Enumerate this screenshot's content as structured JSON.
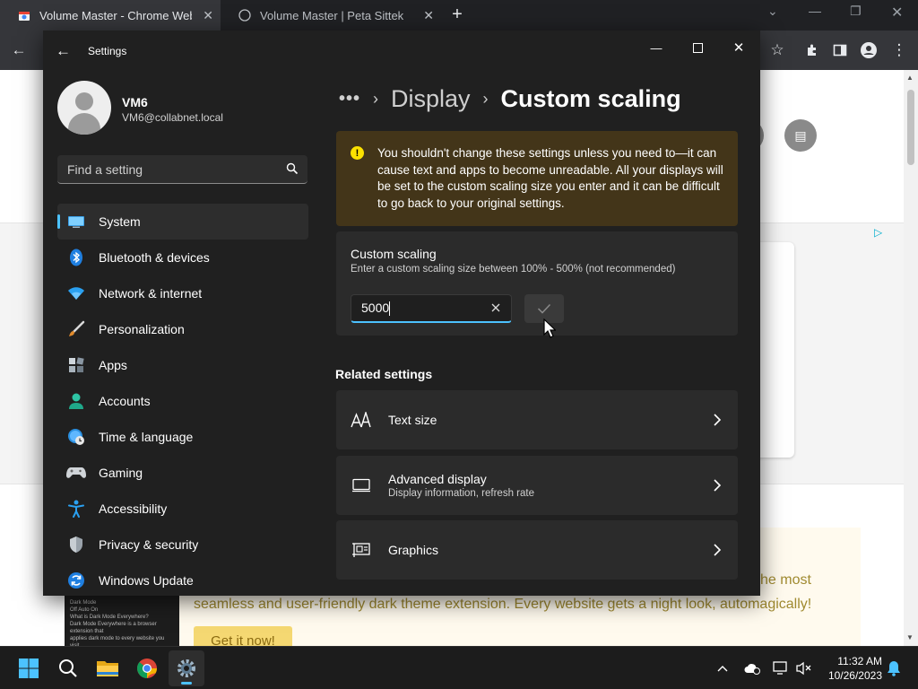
{
  "browser": {
    "tabs": [
      {
        "title": "Volume Master - Chrome Web Store",
        "active": true
      },
      {
        "title": "Volume Master | Peta Sittek",
        "active": false
      }
    ],
    "page": {
      "body_text": "seamless and user-friendly dark theme extension. Every website gets a night look, automagically!",
      "body_text_right": "he most",
      "cta_label": "Get it now!",
      "thumb_lines": [
        "Dark Mode",
        "Off   Auto   On",
        "What is Dark Mode Everywhere?",
        "Dark Mode Everywhere is a browser extension that",
        "applies dark mode to every website you visit."
      ]
    }
  },
  "settings": {
    "app_title": "Settings",
    "user": {
      "name": "VM6",
      "email": "VM6@collabnet.local"
    },
    "search": {
      "placeholder": "Find a setting"
    },
    "nav": [
      {
        "label": "System",
        "icon": "system-icon",
        "selected": true
      },
      {
        "label": "Bluetooth & devices",
        "icon": "bluetooth-icon"
      },
      {
        "label": "Network & internet",
        "icon": "wifi-icon"
      },
      {
        "label": "Personalization",
        "icon": "brush-icon"
      },
      {
        "label": "Apps",
        "icon": "apps-icon"
      },
      {
        "label": "Accounts",
        "icon": "person-icon"
      },
      {
        "label": "Time & language",
        "icon": "globe-clock-icon"
      },
      {
        "label": "Gaming",
        "icon": "gamepad-icon"
      },
      {
        "label": "Accessibility",
        "icon": "accessibility-icon"
      },
      {
        "label": "Privacy & security",
        "icon": "shield-icon"
      },
      {
        "label": "Windows Update",
        "icon": "update-icon"
      }
    ],
    "breadcrumb": {
      "more": "•••",
      "sep": "›",
      "parent": "Display",
      "current": "Custom scaling"
    },
    "warning": {
      "icon_glyph": "!",
      "text": "You shouldn't change these settings unless you need to—it can cause text and apps to become unreadable. All your displays will be set to the custom scaling size you enter and it can be difficult to go back to your original settings."
    },
    "custom_scaling": {
      "title": "Custom scaling",
      "description": "Enter a custom scaling size between 100% - 500% (not recommended)",
      "value": "5000"
    },
    "related": {
      "title": "Related settings",
      "items": [
        {
          "label": "Text size",
          "sub": "",
          "icon": "text-size-icon"
        },
        {
          "label": "Advanced display",
          "sub": "Display information, refresh rate",
          "icon": "monitor-icon"
        },
        {
          "label": "Graphics",
          "sub": "",
          "icon": "graphics-card-icon"
        }
      ]
    }
  },
  "taskbar": {
    "time": "11:32 AM",
    "date": "10/26/2023"
  },
  "colors": {
    "accent": "#4cc2ff",
    "warning_bg": "#433519",
    "window_bg": "#202020",
    "card_bg": "#2b2b2b"
  }
}
